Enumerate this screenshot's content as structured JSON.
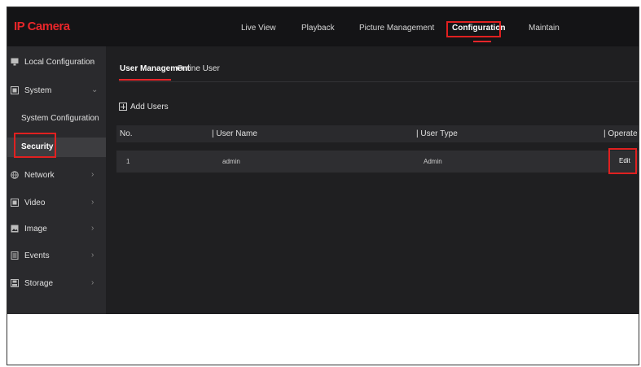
{
  "app": {
    "brand": "IP Camera"
  },
  "nav": {
    "live_view": "Live View",
    "playback": "Playback",
    "picture_management": "Picture Management",
    "configuration": "Configuration",
    "maintain": "Maintain"
  },
  "sidebar": {
    "local_configuration": "Local Configuration",
    "system": "System",
    "system_configuration": "System Configuration",
    "security": "Security",
    "network": "Network",
    "video": "Video",
    "image": "Image",
    "events": "Events",
    "storage": "Storage"
  },
  "tabs": {
    "user_management": "User Management",
    "online_user": "Online User"
  },
  "toolbar": {
    "add_users": "Add Users"
  },
  "table": {
    "columns": [
      "No.",
      "| User Name",
      "| User Type",
      "| Operate"
    ],
    "rows": [
      {
        "no": "1",
        "user_name": "admin",
        "user_type": "Admin",
        "operate": "Edit"
      }
    ]
  },
  "colors": {
    "accent": "#e8262a",
    "highlight": "#e02020",
    "background": "#1f1f21",
    "sidebar": "#2a2a2d"
  },
  "icons": {
    "local_configuration": "monitor-icon",
    "system": "system-icon",
    "network": "globe-icon",
    "video": "video-icon",
    "image": "image-icon",
    "events": "events-icon",
    "storage": "storage-icon",
    "add_users": "plus-box-icon",
    "expand": "chevron-right-icon",
    "collapse": "chevron-down-icon"
  }
}
